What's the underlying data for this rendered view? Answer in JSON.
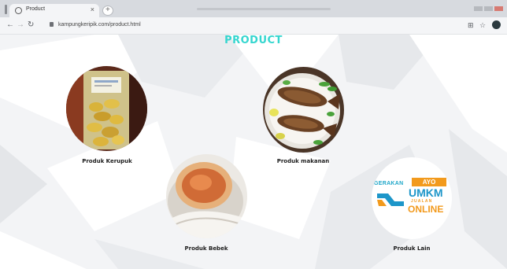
{
  "browser": {
    "tab_title": "Product",
    "tab_close": "×",
    "new_tab": "+",
    "url": "kampungkeripik.com/product.html",
    "back_icon": "←",
    "forward_icon": "→",
    "reload_icon": "↻",
    "translate_icon": "⊞",
    "star_icon": "☆"
  },
  "page": {
    "title": "PRODUCT",
    "products": [
      {
        "name": "Produk Kerupuk",
        "image": "bag of crackers"
      },
      {
        "name": "Produk makanan",
        "image": "grilled fish on plate"
      },
      {
        "name": "Produk Bebek",
        "image": "salted duck egg"
      },
      {
        "name": "Produk Lain",
        "image": "UMKM logo"
      }
    ],
    "logo": {
      "gerakan": "GERAKAN",
      "ayo": "AYO",
      "umkm": "UMKM",
      "jualan": "JUALAN",
      "online": "ONLINE"
    }
  },
  "colors": {
    "title": "#35d6cf",
    "logo_blue": "#1d96c9",
    "logo_orange": "#f29a1d"
  }
}
